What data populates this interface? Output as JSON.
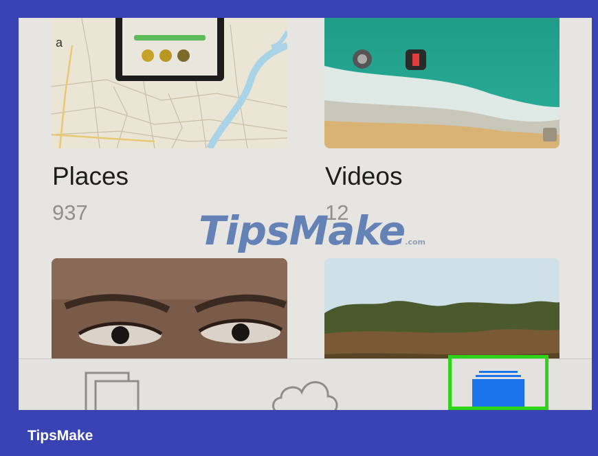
{
  "albums": [
    {
      "title": "Places",
      "count": "937",
      "map_label": "a"
    },
    {
      "title": "Videos",
      "count": "12"
    },
    {
      "title": "",
      "count": ""
    },
    {
      "title": "",
      "count": ""
    }
  ],
  "watermark": {
    "main": "TipsMake",
    "suffix": ".com"
  },
  "tabs": [
    {
      "icon": "photos-icon"
    },
    {
      "icon": "cloud-icon"
    },
    {
      "icon": "albums-icon",
      "active": true
    }
  ],
  "brand": "TipsMake",
  "colors": {
    "frame": "#3a43b4",
    "highlight": "#2ed41a",
    "active_tab": "#1a73ea",
    "screen_bg": "#e7e5e2"
  }
}
